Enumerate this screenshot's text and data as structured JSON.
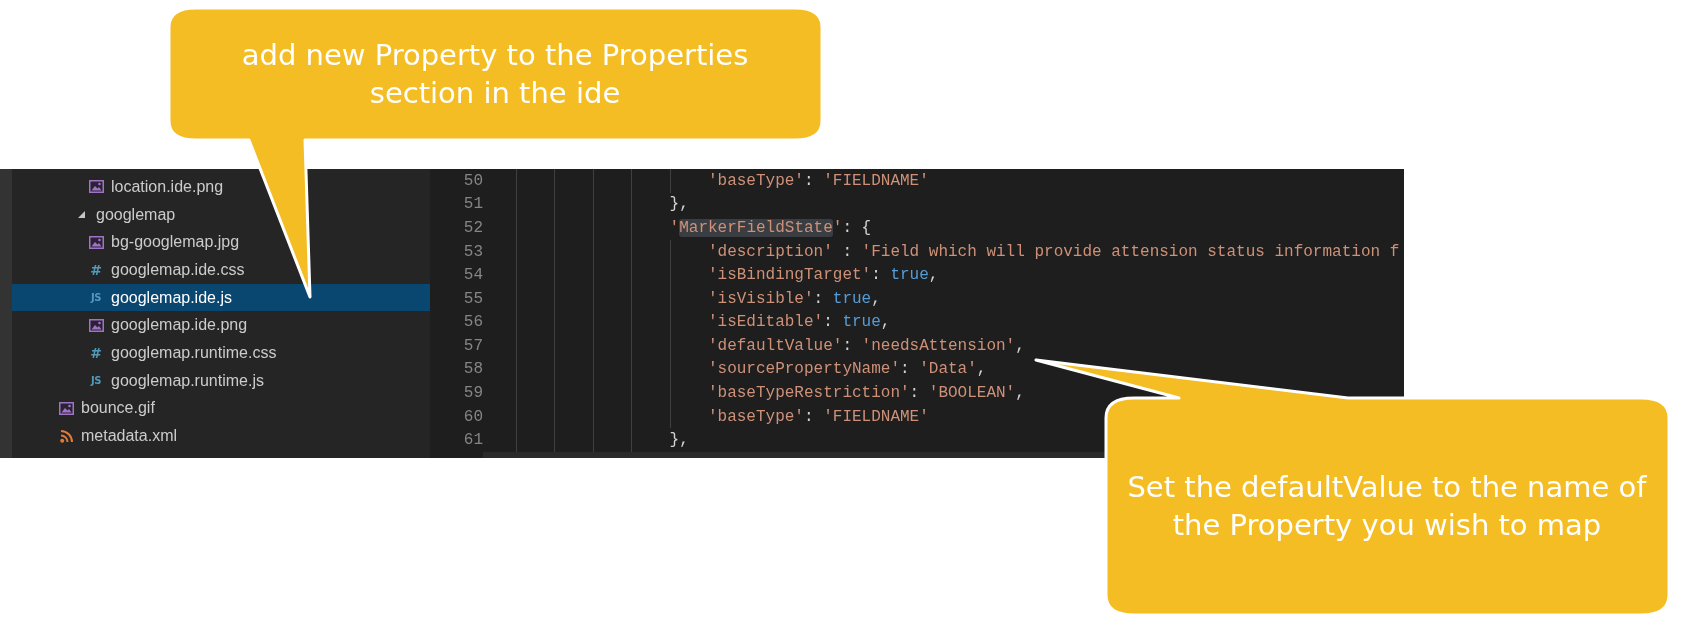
{
  "sidebar": {
    "tree": [
      {
        "children": [
          {
            "children": [
              {
                "kind": "image",
                "label": "location.ide.png",
                "selected": false
              }
            ]
          },
          {
            "kind": "folder",
            "label": "googlemap",
            "expanded": true,
            "selected": false,
            "children": [
              {
                "kind": "image",
                "label": "bg-googlemap.jpg",
                "selected": false
              },
              {
                "kind": "css",
                "glyph": "#",
                "label": "googlemap.ide.css",
                "selected": false
              },
              {
                "kind": "js",
                "glyph": "JS",
                "label": "googlemap.ide.js",
                "selected": true
              },
              {
                "kind": "image",
                "label": "googlemap.ide.png",
                "selected": false
              },
              {
                "kind": "css",
                "glyph": "#",
                "label": "googlemap.runtime.css",
                "selected": false
              },
              {
                "kind": "js",
                "glyph": "JS",
                "label": "googlemap.runtime.js",
                "selected": false
              }
            ]
          }
        ]
      },
      {
        "kind": "image",
        "label": "bounce.gif",
        "selected": false
      },
      {
        "kind": "feed",
        "label": "metadata.xml",
        "selected": false
      }
    ]
  },
  "editor": {
    "lines": [
      {
        "children": [
          {
            "children": [
              {
                "children": [
                  {
                    "children": [
                      {
                        "children": [
                          {
                            "number": "50",
                            "tokens": [
                              {
                                "kind": "string",
                                "text": "'baseType'"
                              },
                              {
                                "kind": "punct",
                                "text": ": "
                              },
                              {
                                "kind": "string",
                                "text": "'FIELDNAME'"
                              }
                            ]
                          }
                        ]
                      },
                      {
                        "number": "51",
                        "tokens": [
                          {
                            "kind": "punct",
                            "text": "},"
                          }
                        ]
                      },
                      {
                        "number": "52",
                        "tokens": [
                          {
                            "kind": "string",
                            "text": "'"
                          },
                          {
                            "kind": "highlight",
                            "text": "MarkerFieldState"
                          },
                          {
                            "kind": "string",
                            "text": "'"
                          },
                          {
                            "kind": "punct",
                            "text": ": {"
                          }
                        ],
                        "children": [
                          {
                            "number": "53",
                            "tokens": [
                              {
                                "kind": "string",
                                "text": "'description'"
                              },
                              {
                                "kind": "punct",
                                "text": " : "
                              },
                              {
                                "kind": "string",
                                "text": "'Field which will provide attension status information f"
                              }
                            ]
                          },
                          {
                            "number": "54",
                            "tokens": [
                              {
                                "kind": "string",
                                "text": "'isBindingTarget'"
                              },
                              {
                                "kind": "punct",
                                "text": ": "
                              },
                              {
                                "kind": "keyword",
                                "text": "true"
                              },
                              {
                                "kind": "punct",
                                "text": ","
                              }
                            ]
                          },
                          {
                            "number": "55",
                            "tokens": [
                              {
                                "kind": "string",
                                "text": "'isVisible'"
                              },
                              {
                                "kind": "punct",
                                "text": ": "
                              },
                              {
                                "kind": "keyword",
                                "text": "true"
                              },
                              {
                                "kind": "punct",
                                "text": ","
                              }
                            ]
                          },
                          {
                            "number": "56",
                            "tokens": [
                              {
                                "kind": "string",
                                "text": "'isEditable'"
                              },
                              {
                                "kind": "punct",
                                "text": ": "
                              },
                              {
                                "kind": "keyword",
                                "text": "true"
                              },
                              {
                                "kind": "punct",
                                "text": ","
                              }
                            ]
                          },
                          {
                            "number": "57",
                            "tokens": [
                              {
                                "kind": "string",
                                "text": "'defaultValue'"
                              },
                              {
                                "kind": "punct",
                                "text": ": "
                              },
                              {
                                "kind": "string",
                                "text": "'needsAttension'"
                              },
                              {
                                "kind": "punct",
                                "text": ","
                              }
                            ]
                          },
                          {
                            "number": "58",
                            "tokens": [
                              {
                                "kind": "string",
                                "text": "'sourcePropertyName'"
                              },
                              {
                                "kind": "punct",
                                "text": ": "
                              },
                              {
                                "kind": "string",
                                "text": "'Data'"
                              },
                              {
                                "kind": "punct",
                                "text": ","
                              }
                            ]
                          },
                          {
                            "number": "59",
                            "tokens": [
                              {
                                "kind": "string",
                                "text": "'baseTypeRestriction'"
                              },
                              {
                                "kind": "punct",
                                "text": ": "
                              },
                              {
                                "kind": "string",
                                "text": "'BOOLEAN'"
                              },
                              {
                                "kind": "punct",
                                "text": ","
                              }
                            ]
                          },
                          {
                            "number": "60",
                            "tokens": [
                              {
                                "kind": "string",
                                "text": "'baseType'"
                              },
                              {
                                "kind": "punct",
                                "text": ": "
                              },
                              {
                                "kind": "string",
                                "text": "'FIELDNAME'"
                              }
                            ]
                          }
                        ]
                      },
                      {
                        "number": "61",
                        "tokens": [
                          {
                            "kind": "punct",
                            "text": "},"
                          }
                        ]
                      }
                    ]
                  }
                ]
              }
            ]
          }
        ]
      }
    ]
  },
  "callouts": [
    {
      "text": "add new Property to the Properties section in the ide"
    },
    {
      "text": "Set the defaultValue to the name of the Property you wish to map"
    }
  ]
}
